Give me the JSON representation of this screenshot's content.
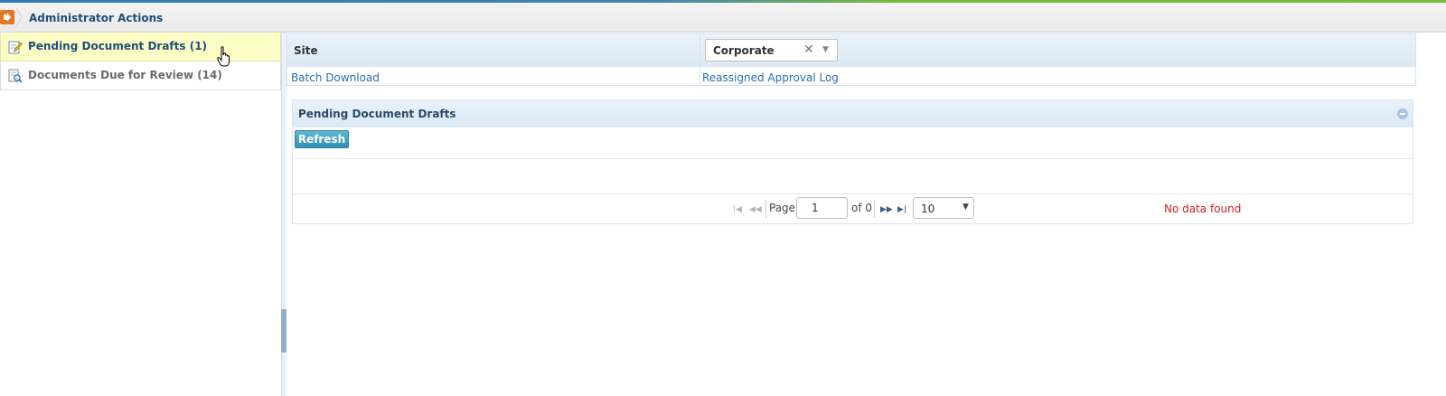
{
  "breadcrumb": {
    "title": "Administrator Actions"
  },
  "leftnav": {
    "items": [
      {
        "label": "Pending Document Drafts (1)",
        "active": true
      },
      {
        "label": "Documents Due for Review (14)",
        "active": false
      }
    ]
  },
  "site": {
    "label": "Site",
    "selected": "Corporate",
    "clear_icon": "✕",
    "links": [
      "Batch Download",
      "Reassigned Approval Log"
    ]
  },
  "pending_panel": {
    "title": "Pending Document Drafts",
    "refresh_label": "Refresh",
    "pager": {
      "page_label": "Page",
      "page_value": "1",
      "of_label": "of 0",
      "page_size": "10",
      "status": "No data found"
    }
  },
  "colors": {
    "accent": "#2a6fb4",
    "active_row": "#fdfdc6",
    "error": "#d41c1c",
    "button": "#3391b4"
  }
}
